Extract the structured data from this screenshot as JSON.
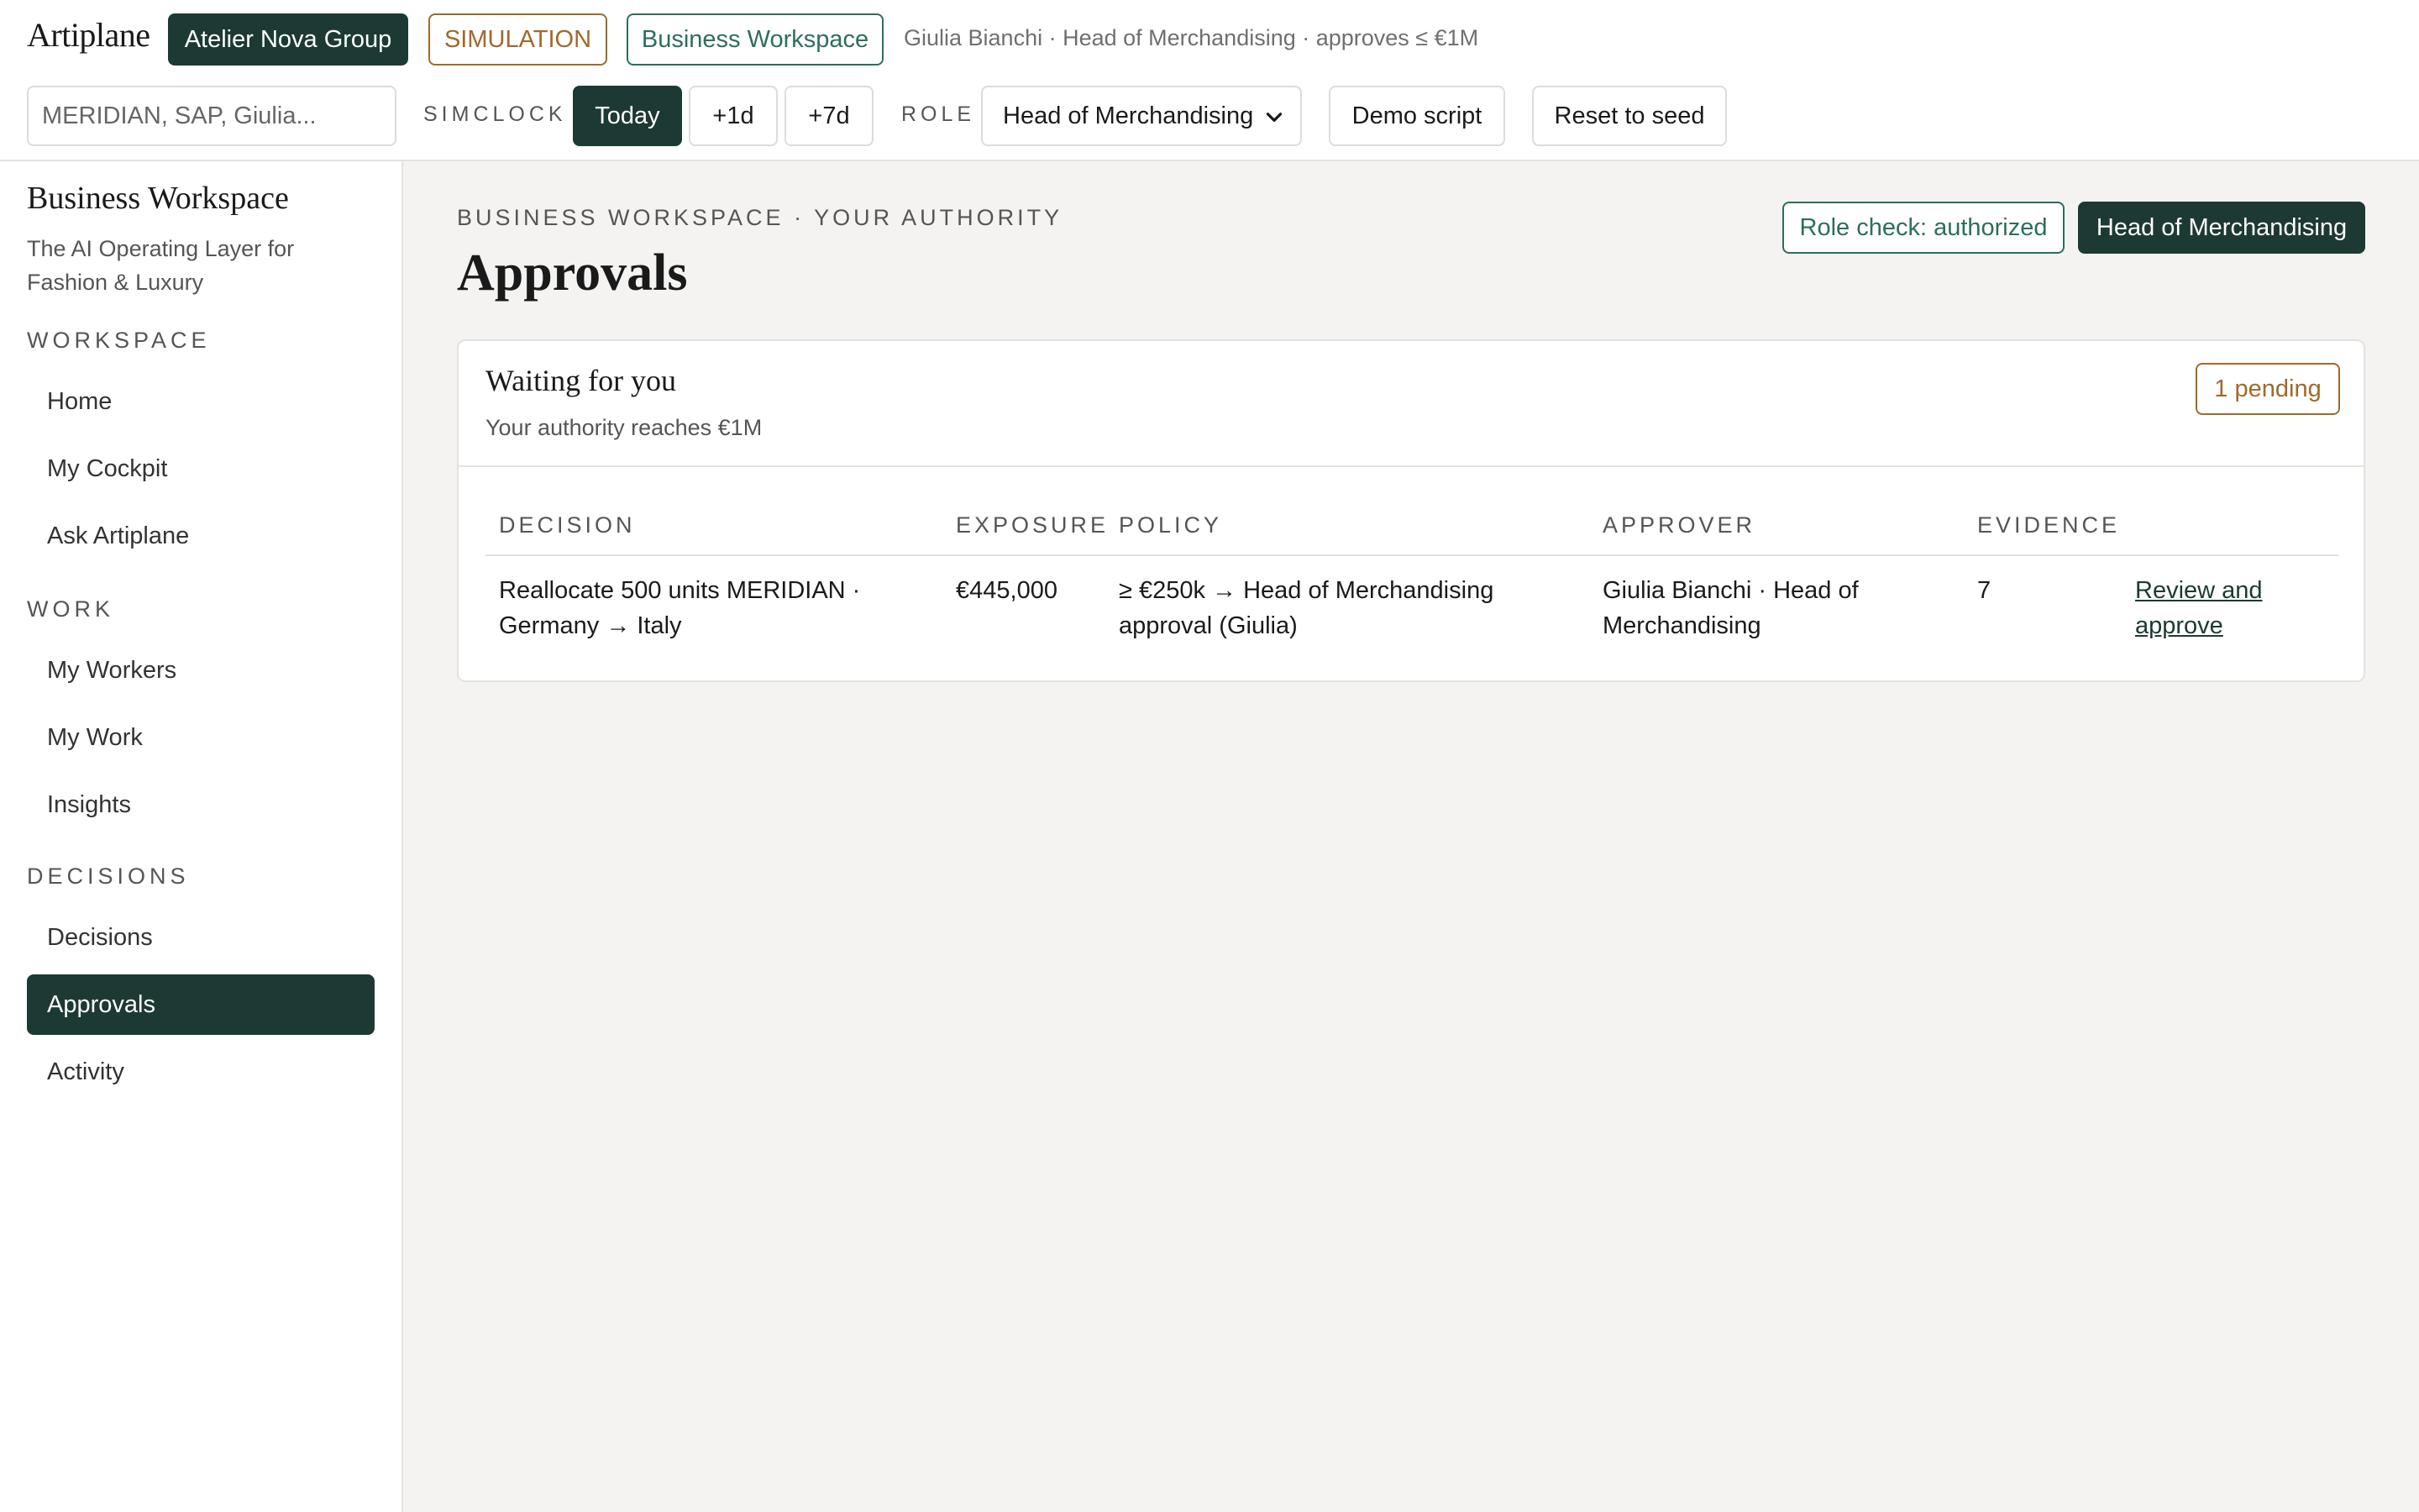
{
  "app": {
    "brand": "Artiplane",
    "org": "Atelier Nova Group",
    "mode": "SIMULATION",
    "workspace": "Business Workspace",
    "user_info": "Giulia Bianchi · Head of Merchandising · approves ≤ €1M"
  },
  "toolbar": {
    "search_placeholder": "MERIDIAN, SAP, Giulia...",
    "simclock_label": "SIMCLOCK",
    "today": "Today",
    "plus_1d": "+1d",
    "plus_7d": "+7d",
    "role_label": "ROLE",
    "role_selected": "Head of Merchandising",
    "demo_script": "Demo script",
    "reset": "Reset to seed"
  },
  "sidebar": {
    "title": "Business Workspace",
    "tagline": "The AI Operating Layer for Fashion & Luxury",
    "sections": [
      {
        "label": "WORKSPACE",
        "items": [
          "Home",
          "My Cockpit",
          "Ask Artiplane"
        ]
      },
      {
        "label": "WORK",
        "items": [
          "My Workers",
          "My Work",
          "Insights"
        ]
      },
      {
        "label": "DECISIONS",
        "items": [
          "Decisions",
          "Approvals",
          "Activity"
        ]
      }
    ],
    "active": "Approvals"
  },
  "main": {
    "breadcrumb": "BUSINESS WORKSPACE · YOUR AUTHORITY",
    "title": "Approvals",
    "role_check": "Role check: authorized",
    "role_badge": "Head of Merchandising",
    "card": {
      "title": "Waiting for you",
      "subtitle": "Your authority reaches €1M",
      "pending": "1 pending",
      "columns": [
        "DECISION",
        "EXPOSURE",
        "POLICY",
        "APPROVER",
        "EVIDENCE"
      ],
      "rows": [
        {
          "decision": "Reallocate 500 units MERIDIAN · Germany → Italy",
          "exposure": "€445,000",
          "policy": "≥ €250k → Head of Merchandising approval (Giulia)",
          "approver": "Giulia Bianchi · Head of Merchandising",
          "evidence": "7",
          "action": "Review and approve"
        }
      ]
    }
  },
  "colors": {
    "accent_dark": "#1c3a33",
    "accent_green": "#2c6e5c",
    "simulation_amber": "#a0692b",
    "background": "#f4f3f1"
  },
  "icons": {
    "role_select_chevron": "chevron-down-icon"
  }
}
